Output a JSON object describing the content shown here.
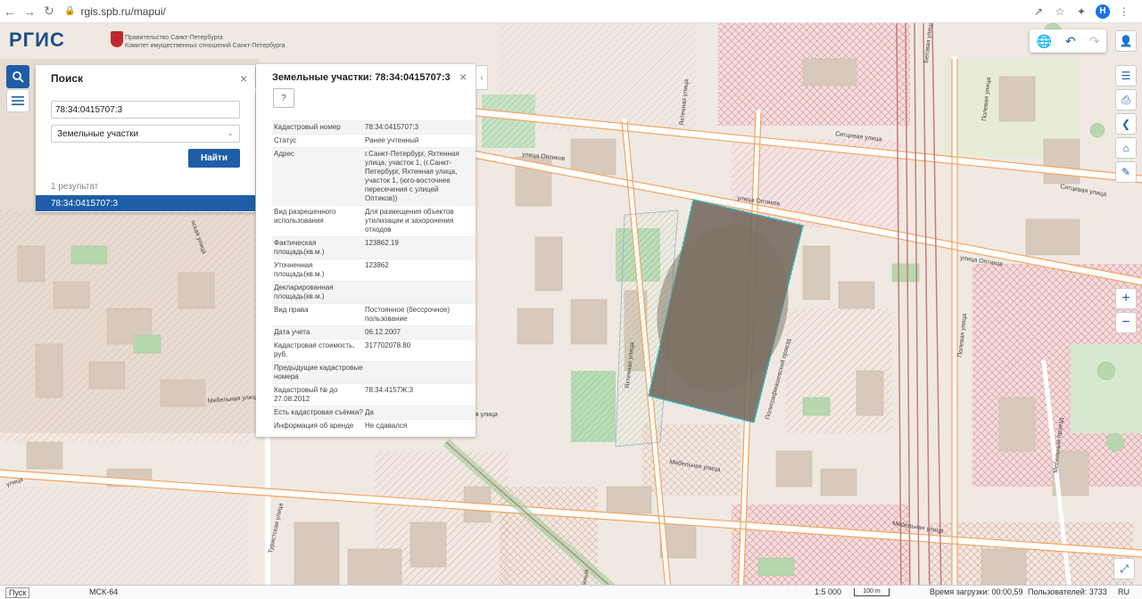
{
  "browser": {
    "url": "rgis.spb.ru/mapui/"
  },
  "header": {
    "logo": "РГИС",
    "org_line1": "Правительство Санкт-Петербурга",
    "org_line2": "Комитет имущественных отношений Санкт-Петербурга"
  },
  "search": {
    "title": "Поиск",
    "query": "78:34:0415707:3",
    "type_selected": "Земельные участки",
    "button": "Найти",
    "count": "1 результат",
    "result": "78:34:0415707:3"
  },
  "info": {
    "title": "Земельные участки: 78:34:0415707:3",
    "help": "?",
    "rows": [
      {
        "k": "Кадастровый номер",
        "v": "78:34:0415707:3"
      },
      {
        "k": "Статус",
        "v": "Ранее учтенный"
      },
      {
        "k": "Адрес",
        "v": "г.Санкт-Петербург, Яхтенная улица, участок 1, (г.Санкт-Петербург, Яхтенная улица, участок 1, (юго-восточнее пересечения с улицей Оптиков))"
      },
      {
        "k": "Вид разрешенного использования",
        "v": "Для размещения объектов утилизации и захоронения отходов"
      },
      {
        "k": "Фактическая площадь(кв.м.)",
        "v": "123862.19"
      },
      {
        "k": "Уточненная площадь(кв.м.)",
        "v": "123862"
      },
      {
        "k": "Декларированная площадь(кв.м.)",
        "v": ""
      },
      {
        "k": "Вид права",
        "v": "Постоянное (бессрочное) пользование"
      },
      {
        "k": "Дата учета",
        "v": "06.12.2007"
      },
      {
        "k": "Кадастровая стоимость, руб.",
        "v": "317702078.80"
      },
      {
        "k": "Предыдущие кадастровые номера",
        "v": ""
      },
      {
        "k": "Кадастровый № до 27.08.2012",
        "v": "78:34:4157Ж:3"
      },
      {
        "k": "Есть кадастровая съёмка?",
        "v": "Да"
      },
      {
        "k": "Информация об аренде",
        "v": "Не сдавался"
      }
    ]
  },
  "map_labels": {
    "optikov1": "улица Оптиков",
    "optikov2": "улица Оптиков",
    "optikov3": "улица Оптиков",
    "sitcevaya1": "Ситцевая улица",
    "sitcevaya2": "Ситцевая улица",
    "yakhtennaya": "Яхтенная улица",
    "mebelnaya1": "Мебельная улица",
    "mebelnaya2": "Мебельная улица",
    "mebelnaya3": "Мебельная улица",
    "mebelnaya4": "Мебельная улица",
    "poligrafmash": "Полиграфмашевский проезд",
    "polevaya": "Полевая улица",
    "mebelny_proezd": "Мебельный проезд",
    "turistskaya": "Туристская улица",
    "lyzhny": "Лыжный",
    "beguvaya": "Беговая улица",
    "left_ul": "улица",
    "left_ul2": "нская улица"
  },
  "status": {
    "start": "Пуск",
    "crs": "МСК-64",
    "scale": "1:5 000",
    "scale_bar": "100 m",
    "load_time": "Время загрузки: 00:00,59",
    "users": "Пользователей: 3733",
    "lang": "RU"
  },
  "colors": {
    "accent": "#1e5ea8",
    "parcel_fill": "#6e6458",
    "parcel_border": "#2ab8c8"
  }
}
